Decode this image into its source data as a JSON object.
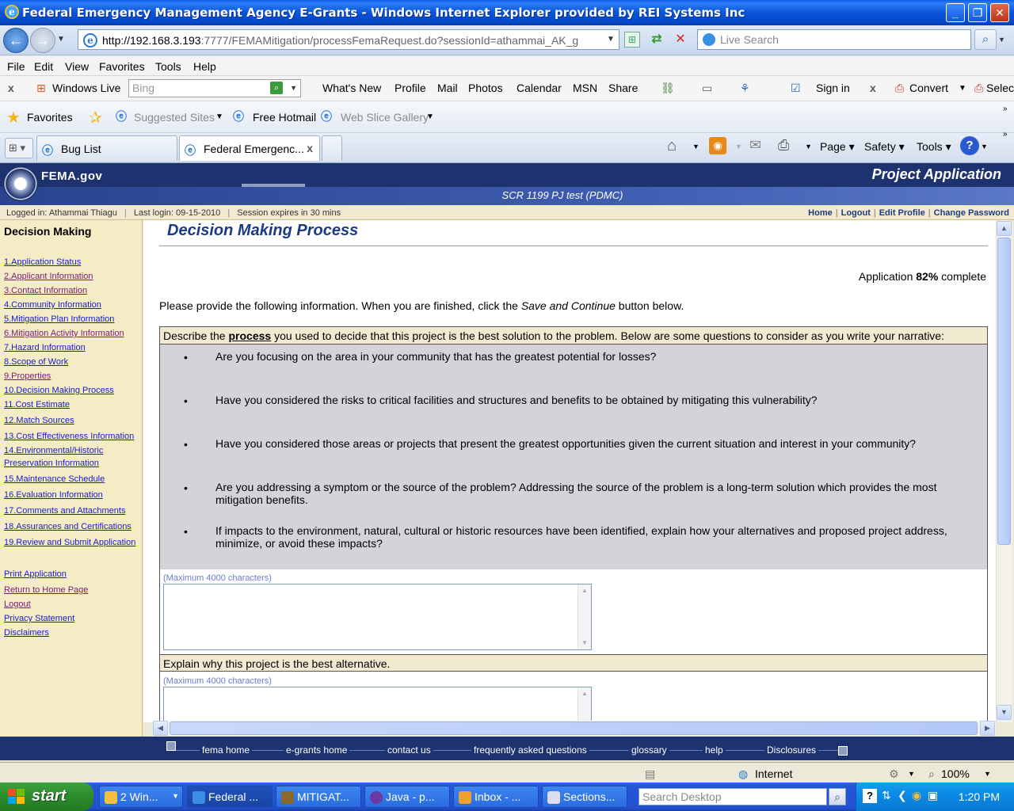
{
  "window": {
    "title": "Federal Emergency Management Agency E-Grants - Windows Internet Explorer provided by REI Systems Inc"
  },
  "address_bar": {
    "url_host": "http://192.168.3.193",
    "url_rest": ":7777/FEMAMitigation/processFemaRequest.do?sessionId=athammai_AK_g",
    "search_placeholder": "Live Search"
  },
  "menu": [
    "File",
    "Edit",
    "View",
    "Favorites",
    "Tools",
    "Help"
  ],
  "live_toolbar": {
    "close": "x",
    "brand": "Windows Live",
    "search_placeholder": "Bing",
    "links": [
      "What's New",
      "Profile",
      "Mail",
      "Photos",
      "Calendar",
      "MSN",
      "Share"
    ],
    "sign_in": "Sign in",
    "close2": "x",
    "convert": "Convert",
    "select": "Selec"
  },
  "favorites_bar": {
    "favorites": "Favorites",
    "suggested": "Suggested Sites",
    "hotmail": "Free Hotmail",
    "webslice": "Web Slice Gallery"
  },
  "tabs": [
    {
      "label": "Bug List"
    },
    {
      "label": "Federal Emergenc..."
    }
  ],
  "tab_close": "x",
  "command_bar": {
    "page": "Page",
    "safety": "Safety",
    "tools": "Tools"
  },
  "header": {
    "logo": "FEMA.gov",
    "section": "Project Application",
    "subtitle": "SCR 1199 PJ test (PDMC)"
  },
  "user_bar": {
    "logged_in": "Logged in: Athammai Thiagu",
    "last_login": "Last login: 09-15-2010",
    "session": "Session expires in 30 mins",
    "links": [
      "Home",
      "Logout",
      "Edit Profile",
      "Change Password"
    ]
  },
  "left_nav": {
    "heading": "Decision Making",
    "items": [
      {
        "label": "1.Application Status",
        "visited": false
      },
      {
        "label": "2.Applicant Information",
        "visited": true
      },
      {
        "label": "3.Contact Information",
        "visited": true
      },
      {
        "label": "4.Community Information",
        "visited": false
      },
      {
        "label": "5.Mitigation Plan Information",
        "visited": false
      },
      {
        "label": "6.Mitigation Activity Information",
        "visited": true
      },
      {
        "label": "7.Hazard Information",
        "visited": false
      },
      {
        "label": "8.Scope of Work",
        "visited": false
      },
      {
        "label": "9.Properties",
        "visited": true
      },
      {
        "label": "10.Decision Making Process",
        "visited": false
      },
      {
        "label": "11.Cost Estimate",
        "visited": false
      },
      {
        "label": "12.Match Sources",
        "visited": false
      },
      {
        "label": "13.Cost Effectiveness Information",
        "visited": false
      },
      {
        "label": "14.Environmental/Historic",
        "label2": "Preservation Information",
        "visited": false
      },
      {
        "label": "15.Maintenance Schedule",
        "visited": false
      },
      {
        "label": "16.Evaluation Information",
        "visited": false
      },
      {
        "label": "17.Comments and Attachments",
        "visited": false
      },
      {
        "label": "18.Assurances and Certifications",
        "visited": false
      },
      {
        "label": "19.Review and Submit Application",
        "visited": false
      }
    ],
    "extra": [
      "Print Application",
      "Return to Home Page",
      "Logout",
      "Privacy Statement",
      "Disclaimers"
    ]
  },
  "main": {
    "title": "Decision Making Process",
    "progress_prefix": "Application ",
    "progress_value": "82%",
    "progress_suffix": " complete",
    "instr_prefix": "Please provide the following information. When you are finished, click the ",
    "instr_em": "Save and Continue",
    "instr_suffix": " button below.",
    "q1_prefix": "Describe the ",
    "q1_bold": "process",
    "q1_suffix": " you used to decide that this project is the best solution to the problem. Below are some questions to consider as you write your narrative:",
    "bullets": [
      "Are you focusing on the area in your community that has the greatest potential for losses?",
      "Have you considered the risks to critical facilities and structures and benefits to be obtained by mitigating this vulnerability?",
      "Have you considered those areas or projects that present the greatest opportunities given the current situation and interest in your community?",
      "Are you addressing a symptom or the source of the problem? Addressing the source of the problem is a long-term solution which provides the most mitigation benefits.",
      "If impacts to the environment, natural, cultural or historic resources have been identified, explain how your alternatives and proposed project address, minimize, or avoid these impacts?"
    ],
    "bullet_char": "•",
    "max_chars": "(Maximum 4000 characters)",
    "q2": "Explain why this project is the best alternative."
  },
  "footer": {
    "links": [
      "fema home",
      "e-grants home",
      "contact us",
      "frequently asked questions",
      "glossary",
      "help",
      "Disclosures"
    ]
  },
  "ie_status": {
    "zone": "Internet",
    "zoom": "100%"
  },
  "taskbar": {
    "start": "start",
    "tasks": [
      "2 Win...",
      "Federal ...",
      "MITIGAT...",
      "Java - p...",
      "Inbox - ...",
      "Sections..."
    ],
    "search_placeholder": "Search Desktop",
    "clock": "1:20 PM"
  }
}
